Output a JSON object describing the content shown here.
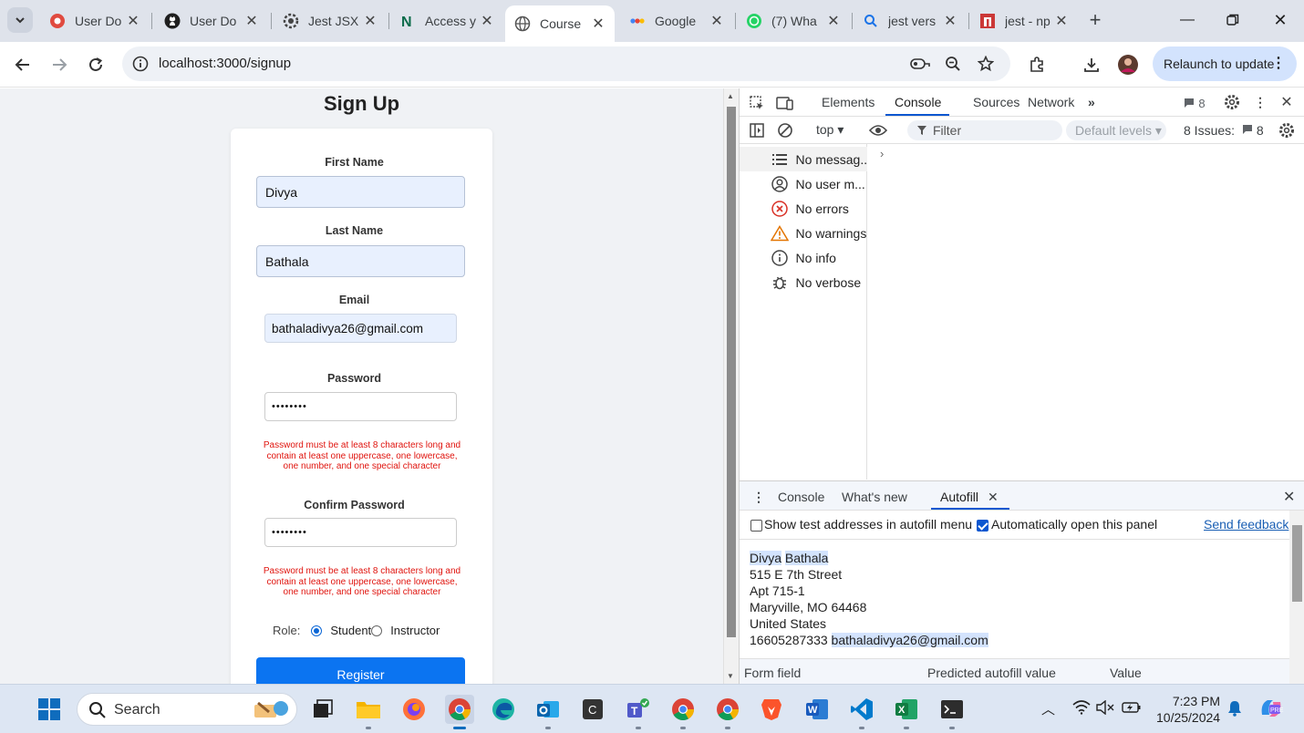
{
  "browser": {
    "tabs": [
      {
        "title": "User Do",
        "icon": "gear-red-icon",
        "active": false
      },
      {
        "title": "User Do",
        "icon": "github-icon",
        "active": false
      },
      {
        "title": "Jest JSX",
        "icon": "gear-icon",
        "active": false
      },
      {
        "title": "Access y",
        "icon": "notion-icon",
        "active": false
      },
      {
        "title": "Course",
        "icon": "globe-icon",
        "active": true
      },
      {
        "title": "Google",
        "icon": "google-icon",
        "active": false
      },
      {
        "title": "(7) Wha",
        "icon": "whatsapp-icon",
        "active": false
      },
      {
        "title": "jest vers",
        "icon": "search-icon",
        "active": false
      },
      {
        "title": "jest - np",
        "icon": "npm-icon",
        "active": false
      }
    ],
    "url": "localhost:3000/signup",
    "relaunch_label": "Relaunch to update"
  },
  "page": {
    "title": "Sign Up",
    "first_name_label": "First Name",
    "first_name_value": "Divya",
    "last_name_label": "Last Name",
    "last_name_value": "Bathala",
    "email_label": "Email",
    "email_value": "bathaladivya26@gmail.com",
    "password_label": "Password",
    "password_value": "••••••••",
    "password_error": "Password must be at least 8 characters long and contain at least one uppercase, one lowercase, one number, and one special character",
    "confirm_label": "Confirm Password",
    "confirm_value": "••••••••",
    "confirm_error": "Password must be at least 8 characters long and contain at least one uppercase, one lowercase, one number, and one special character",
    "role_label": "Role:",
    "role_student": "Student",
    "role_instructor": "Instructor",
    "register_label": "Register"
  },
  "devtools": {
    "tabs": [
      "Elements",
      "Console",
      "Sources",
      "Network"
    ],
    "message_count": "8",
    "context": "top",
    "filter_placeholder": "Filter",
    "levels": "Default levels",
    "issues_label": "8 Issues:",
    "issues_count": "8",
    "sidebar": [
      {
        "label": "No messag...",
        "icon": "list-icon"
      },
      {
        "label": "No user m...",
        "icon": "user-icon"
      },
      {
        "label": "No errors",
        "icon": "error-icon"
      },
      {
        "label": "No warnings",
        "icon": "warning-icon"
      },
      {
        "label": "No info",
        "icon": "info-icon"
      },
      {
        "label": "No verbose",
        "icon": "bug-icon"
      }
    ],
    "drawer_tabs": [
      "Console",
      "What's new",
      "Autofill"
    ],
    "show_test_addresses": "Show test addresses in autofill menu",
    "auto_open": "Automatically open this panel",
    "send_feedback": "Send feedback",
    "address": {
      "first": "Divya",
      "last": "Bathala",
      "street": "515 E 7th Street",
      "apt": "Apt 715-1",
      "city": "Maryville, MO 64468",
      "country": "United States",
      "phone": "16605287333",
      "email": "bathaladivya26@gmail.com"
    },
    "grid_headers": [
      "Form field",
      "Predicted autofill value",
      "Value"
    ]
  },
  "taskbar": {
    "search_placeholder": "Search",
    "time": "7:23 PM",
    "date": "10/25/2024"
  }
}
